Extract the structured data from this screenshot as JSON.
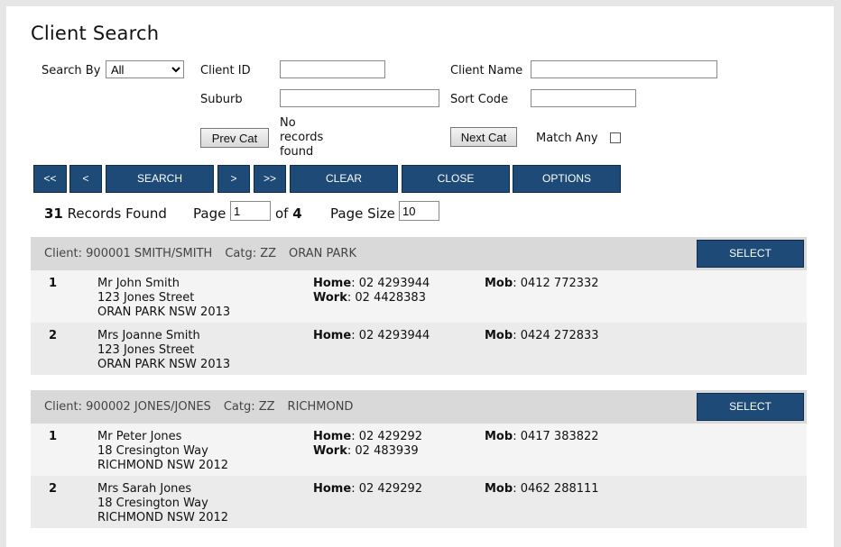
{
  "page_title": "Client Search",
  "form": {
    "search_by_label": "Search By",
    "search_by_value": "All",
    "client_id_label": "Client ID",
    "client_id_value": "",
    "client_name_label": "Client Name",
    "client_name_value": "",
    "suburb_label": "Suburb",
    "suburb_value": "",
    "sort_code_label": "Sort Code",
    "sort_code_value": "",
    "prev_cat_label": "Prev Cat",
    "no_records_line1": "No",
    "no_records_line2": "records",
    "no_records_line3": "found",
    "next_cat_label": "Next Cat",
    "match_any_label": "Match Any"
  },
  "toolbar": {
    "first": "<<",
    "prev": "<",
    "search": "SEARCH",
    "next": ">",
    "last": ">>",
    "clear": "CLEAR",
    "close": "CLOSE",
    "options": "OPTIONS"
  },
  "summary": {
    "records_count": "31",
    "records_text": "Records Found",
    "page_label": "Page",
    "page_value": "1",
    "of_label": "of",
    "total_pages": "4",
    "page_size_label": "Page Size",
    "page_size_value": "10"
  },
  "select_label": "SELECT",
  "home_label": "Home",
  "work_label": "Work",
  "mob_label": "Mob",
  "clients": [
    {
      "client": "Client: 900001 SMITH/SMITH",
      "catg": "Catg: ZZ",
      "suburb": "ORAN PARK",
      "contacts": [
        {
          "num": "1",
          "name": "Mr John Smith",
          "street": "123 Jones Street",
          "locality": "ORAN PARK NSW 2013",
          "home": "02 4293944",
          "work": "02 4428383",
          "mob": "0412 772332"
        },
        {
          "num": "2",
          "name": "Mrs Joanne Smith",
          "street": "123 Jones Street",
          "locality": "ORAN PARK NSW 2013",
          "home": "02 4293944",
          "work": "",
          "mob": "0424 272833"
        }
      ]
    },
    {
      "client": "Client: 900002 JONES/JONES",
      "catg": "Catg: ZZ",
      "suburb": "RICHMOND",
      "contacts": [
        {
          "num": "1",
          "name": "Mr Peter Jones",
          "street": "18 Cresington Way",
          "locality": "RICHMOND NSW 2012",
          "home": "02 429292",
          "work": "02 483939",
          "mob": "0417 383822"
        },
        {
          "num": "2",
          "name": "Mrs Sarah Jones",
          "street": "18 Cresington Way",
          "locality": "RICHMOND NSW 2012",
          "home": "02 429292",
          "work": "",
          "mob": "0462 288111"
        }
      ]
    }
  ]
}
